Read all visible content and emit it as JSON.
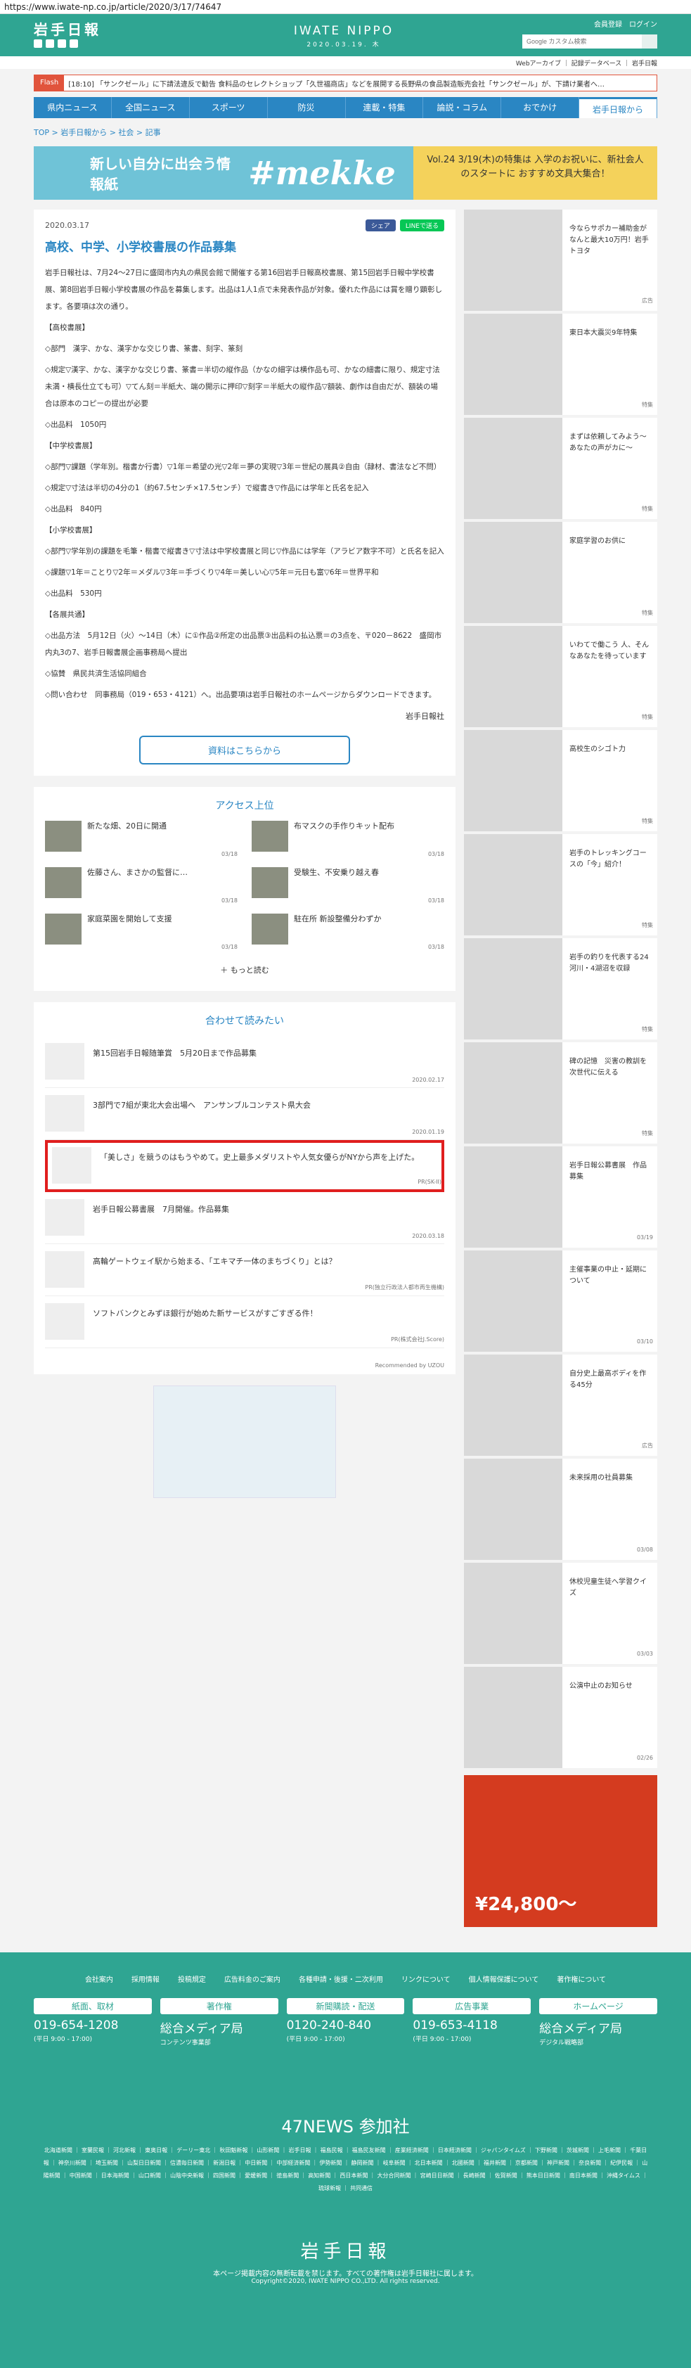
{
  "url": "https://www.iwate-np.co.jp/article/2020/3/17/74647",
  "header": {
    "logo": "岩手日報",
    "brand": "IWATE NIPPO",
    "date": "2020.03.19. 木",
    "links": [
      "会員登録",
      "ログイン"
    ],
    "search_placeholder": "Google カスタム検索",
    "subnav": "Webアーカイブ ｜ 記録データベース ｜ 岩手日報"
  },
  "flash": {
    "tag": "Flash",
    "text": "[18:10] 「サンクゼール」に下請法違反で勧告  食料品のセレクトショップ「久世福商店」などを展開する長野県の食品製造販売会社「サンクゼール」が、下請け業者へ…"
  },
  "nav": [
    "県内ニュース",
    "全国ニュース",
    "スポーツ",
    "防災",
    "連載・特集",
    "論説・コラム",
    "おでかけ",
    "岩手日報から"
  ],
  "breadcrumb": "TOP > 岩手日報から > 社会 > 記事",
  "banner": {
    "left": "新しい自分に出会う情報紙",
    "center": "#mekke",
    "right": "Vol.24 3/19(木)の特集は 入学のお祝いに、新社会人のスタートに おすすめ文具大集合！"
  },
  "article": {
    "date": "2020.03.17",
    "share": [
      "シェア",
      "LINEで送る"
    ],
    "title": "高校、中学、小学校書展の作品募集",
    "paras": [
      "岩手日報社は、7月24～27日に盛岡市内丸の県民会館で開催する第16回岩手日報高校書展、第15回岩手日報中学校書展、第8回岩手日報小学校書展の作品を募集します。出品は1人1点で未発表作品が対象。優れた作品には賞を贈り顕彰します。各要項は次の通り。",
      "【高校書展】",
      "◇部門　漢字、かな、漢字かな交じり書、篆書、刻字、篆刻",
      "◇規定▽漢字、かな、漢字かな交じり書、篆書＝半切の縦作品（かなの細字は横作品も可、かなの細書に限り、規定寸法未満・横長仕立ても可）▽てん刻＝半紙大、端の開示に押印▽刻字＝半紙大の縦作品▽額装、劇作は自由だが、額装の場合は原本のコピーの提出が必要",
      "◇出品料　1050円",
      "【中学校書展】",
      "◇部門▽課題（学年別。楷書か行書）▽1年＝希望の光▽2年＝夢の実現▽3年＝世紀の展具②自由（隷材、書法など不問）",
      "◇規定▽寸法は半切の4分の1（約67.5センチ×17.5センチ）で縦書き▽作品には学年と氏名を記入",
      "◇出品料　840円",
      "【小学校書展】",
      "◇部門▽学年別の課題を毛筆・楷書で縦書き▽寸法は中学校書展と同じ▽作品には学年（アラビア数字不可）と氏名を記入",
      "◇課題▽1年＝ことり▽2年＝メダル▽3年＝手づくり▽4年＝美しい心▽5年＝元日も富▽6年＝世界平和",
      "◇出品料　530円",
      "【各展共通】",
      "◇出品方法　5月12日（火）～14日（木）に①作品②所定の出品票③出品料の払込票＝の3点を、〒020－8622　盛岡市内丸3の7、岩手日報書展企画事務局へ提出",
      "◇協賛　県民共済生活協同組合",
      "◇問い合わせ　同事務局（019・653・4121）へ。出品要項は岩手日報社のホームページからダウンロードできます。"
    ],
    "signature": "岩手日報社",
    "button": "資料はこちらから"
  },
  "access": {
    "title": "アクセス上位",
    "items": [
      {
        "t": "新たな畑、20日に開通",
        "d": "03/18"
      },
      {
        "t": "布マスクの手作りキット配布",
        "d": "03/18"
      },
      {
        "t": "佐藤さん、まさかの監督に…",
        "d": "03/18"
      },
      {
        "t": "受験生、不安乗り越え春",
        "d": "03/18"
      },
      {
        "t": "家庭菜園を開始して支援",
        "d": "03/18"
      },
      {
        "t": "駐在所 新設整備分わずか",
        "d": "03/18"
      }
    ],
    "more": "もっと読む"
  },
  "related": {
    "title": "合わせて読みたい",
    "items": [
      {
        "t": "第15回岩手日報随筆賞　5月20日まで作品募集",
        "d": "2020.02.17"
      },
      {
        "t": "3部門で7組が東北大会出場へ　アンサンブルコンテスト県大会",
        "d": "2020.01.19"
      },
      {
        "t": "「美しさ」を競うのはもうやめて。史上最多メダリストや人気女優らがNYから声を上げた。",
        "d": "PR(SK-II)"
      },
      {
        "t": "岩手日報公募書展　7月開催。作品募集",
        "d": "2020.03.18"
      },
      {
        "t": "高輪ゲートウェイ駅から始まる、「エキマチ一体のまちづくり」とは？",
        "d": "PR(独立行政法人都市再生機構)"
      },
      {
        "t": "ソフトバンクとみずほ銀行が始めた新サービスがすごすぎる件！",
        "d": "PR(株式会社J.Score)"
      }
    ],
    "recommend": "Recommended by UZOU"
  },
  "sidebar": [
    {
      "t": "今ならサポカー補助金がなんと最大10万円！岩手トヨタ",
      "d": "広告"
    },
    {
      "t": "東日本大震災9年特集",
      "d": "特集"
    },
    {
      "t": "まずは依頼してみよう～あなたの声がカに～",
      "d": "特集"
    },
    {
      "t": "家庭学習のお供に",
      "d": "特集"
    },
    {
      "t": "いわてで働こう 人、そんなあなたを待っています",
      "d": "特集"
    },
    {
      "t": "高校生のシゴト力",
      "d": "特集"
    },
    {
      "t": "岩手のトレッキングコースの「今」紹介！",
      "d": "特集"
    },
    {
      "t": "岩手の釣りを代表する24河川・4湖沼を収録",
      "d": "特集"
    },
    {
      "t": "碑の記憶　災害の教訓を次世代に伝える",
      "d": "特集"
    },
    {
      "t": "岩手日報公募書展　作品募集",
      "d": "03/19"
    },
    {
      "t": "主催事業の中止・延期について",
      "d": "03/10"
    },
    {
      "t": "自分史上最高ボディを作る45分",
      "d": "広告"
    },
    {
      "t": "未来採用の社員募集",
      "d": "03/08"
    },
    {
      "t": "休校児童生徒へ学習クイズ",
      "d": "03/03"
    },
    {
      "t": "公演中止のお知らせ",
      "d": "02/26"
    }
  ],
  "ad": {
    "price": "¥24,800～"
  },
  "footer": {
    "links": [
      "会社案内",
      "採用情報",
      "投稿規定",
      "広告料金のご案内",
      "各種申請・後援・二次利用",
      "リンクについて",
      "個人情報保護について",
      "著作権について"
    ],
    "cols": [
      {
        "h": "紙面、取材",
        "tel": "019-654-1208",
        "s": "(平日 9:00 - 17:00)"
      },
      {
        "h": "著作権",
        "tel": "総合メディア局",
        "s": "コンテンツ事業部"
      },
      {
        "h": "新聞購読・配送",
        "tel": "0120-240-840",
        "s": "(平日 9:00 - 17:00)"
      },
      {
        "h": "広告事業",
        "tel": "019-653-4118",
        "s": "(平日 9:00 - 17:00)"
      },
      {
        "h": "ホームページ",
        "tel": "総合メディア局",
        "s": "デジタル戦略部"
      }
    ],
    "news": "47NEWS 参加社",
    "news_row": "北海道新聞 ｜ 室蘭民報 ｜ 河北新報 ｜ 東奥日報 ｜ デーリー東北 ｜ 秋田魁新報 ｜ 山形新聞 ｜ 岩手日報 ｜ 福島民報 ｜ 福島民友新聞 ｜ 産業経済新聞 ｜ 日本経済新聞 ｜ ジャパンタイムズ ｜ 下野新聞 ｜ 茨城新聞 ｜ 上毛新聞 ｜ 千葉日報 ｜ 神奈川新聞 ｜ 埼玉新聞 ｜ 山梨日日新聞 ｜ 信濃毎日新聞 ｜ 新潟日報 ｜ 中日新聞 ｜ 中部経済新聞 ｜ 伊勢新聞 ｜ 静岡新聞 ｜ 岐阜新聞 ｜ 北日本新聞 ｜ 北國新聞 ｜ 福井新聞 ｜ 京都新聞 ｜ 神戸新聞 ｜ 奈良新聞 ｜ 紀伊民報 ｜ 山陽新聞 ｜ 中国新聞 ｜ 日本海新聞 ｜ 山口新聞 ｜ 山陰中央新報 ｜ 四国新聞 ｜ 愛媛新聞 ｜ 徳島新聞 ｜ 高知新聞 ｜ 西日本新聞 ｜ 大分合同新聞 ｜ 宮崎日日新聞 ｜ 長崎新聞 ｜ 佐賀新聞 ｜ 熊本日日新聞 ｜ 南日本新聞 ｜ 沖縄タイムス ｜ 琉球新報 ｜ 共同通信",
    "logo": "岩手日報",
    "copy1": "本ページ掲載内容の無断転載を禁じます。すべての著作権は岩手日報社に属します。",
    "copy2": "Copyright©2020, IWATE NIPPO CO.,LTD. All rights reserved."
  }
}
